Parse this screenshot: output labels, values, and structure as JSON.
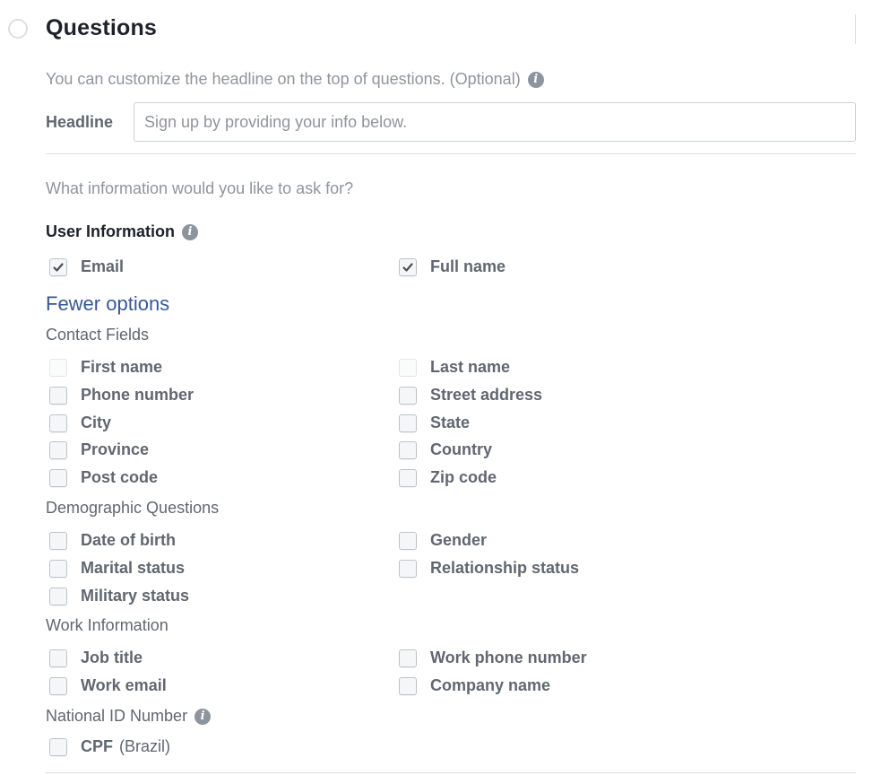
{
  "section": {
    "title": "Questions",
    "help_text": "You can customize the headline on the top of questions. (Optional)",
    "headline_label": "Headline",
    "headline_value": "",
    "headline_placeholder": "Sign up by providing your info below.",
    "ask_text": "What information would you like to ask for?"
  },
  "user_information": {
    "title": "User Information",
    "items": [
      {
        "label": "Email",
        "checked": true
      },
      {
        "label": "Full name",
        "checked": true
      }
    ]
  },
  "fewer_options_label": "Fewer options",
  "groups": {
    "contact": {
      "label": "Contact Fields",
      "items": [
        {
          "label": "First name",
          "checked": false,
          "disabled": true
        },
        {
          "label": "Last name",
          "checked": false,
          "disabled": true
        },
        {
          "label": "Phone number",
          "checked": false
        },
        {
          "label": "Street address",
          "checked": false
        },
        {
          "label": "City",
          "checked": false
        },
        {
          "label": "State",
          "checked": false
        },
        {
          "label": "Province",
          "checked": false
        },
        {
          "label": "Country",
          "checked": false
        },
        {
          "label": "Post code",
          "checked": false
        },
        {
          "label": "Zip code",
          "checked": false
        }
      ]
    },
    "demographic": {
      "label": "Demographic Questions",
      "items": [
        {
          "label": "Date of birth",
          "checked": false
        },
        {
          "label": "Gender",
          "checked": false
        },
        {
          "label": "Marital status",
          "checked": false
        },
        {
          "label": "Relationship status",
          "checked": false
        },
        {
          "label": "Military status",
          "checked": false
        }
      ]
    },
    "work": {
      "label": "Work Information",
      "items": [
        {
          "label": "Job title",
          "checked": false
        },
        {
          "label": "Work phone number",
          "checked": false
        },
        {
          "label": "Work email",
          "checked": false
        },
        {
          "label": "Company name",
          "checked": false
        }
      ]
    },
    "national_id": {
      "label": "National ID Number",
      "items": [
        {
          "label": "CPF",
          "sublabel": "(Brazil)",
          "checked": false
        }
      ]
    }
  },
  "colors": {
    "link": "#365899",
    "check": "#4b4f56",
    "info_icon": "#8d949e"
  }
}
